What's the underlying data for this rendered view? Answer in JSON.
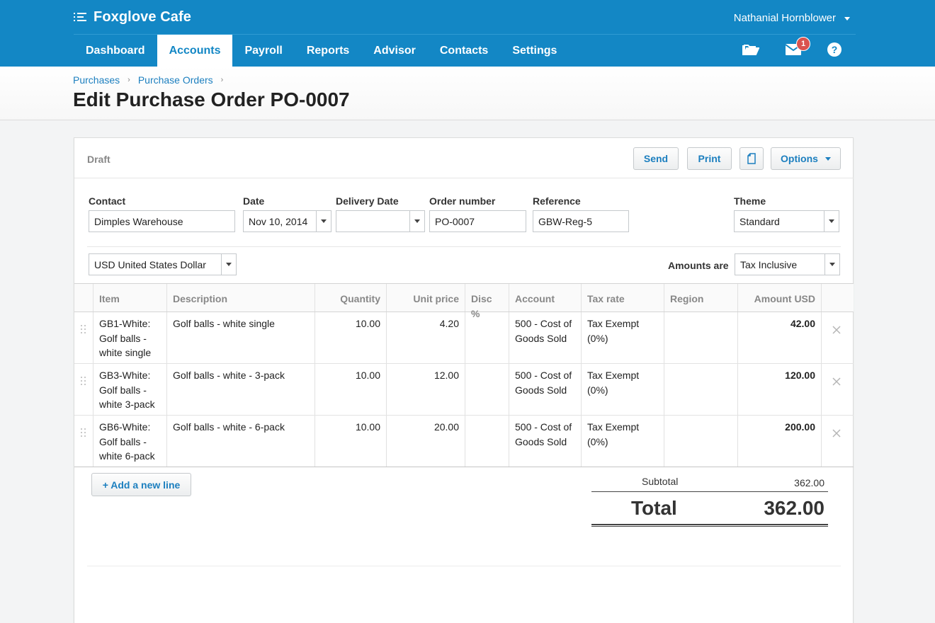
{
  "app": {
    "org_name": "Foxglove Cafe",
    "user_name": "Nathanial Hornblower",
    "notification_count": "1"
  },
  "nav": {
    "tabs": [
      {
        "label": "Dashboard",
        "active": false
      },
      {
        "label": "Accounts",
        "active": true
      },
      {
        "label": "Payroll",
        "active": false
      },
      {
        "label": "Reports",
        "active": false
      },
      {
        "label": "Advisor",
        "active": false
      },
      {
        "label": "Contacts",
        "active": false
      },
      {
        "label": "Settings",
        "active": false
      }
    ],
    "icons": [
      "folder-icon",
      "mail-icon",
      "help-icon"
    ]
  },
  "breadcrumb": [
    "Purchases",
    "Purchase Orders"
  ],
  "page_title": "Edit Purchase Order PO-0007",
  "order": {
    "status": "Draft",
    "actions": {
      "send": "Send",
      "print": "Print",
      "options": "Options"
    },
    "fields": {
      "contact": {
        "label": "Contact",
        "value": "Dimples Warehouse"
      },
      "date": {
        "label": "Date",
        "value": "Nov 10, 2014"
      },
      "delivery_date": {
        "label": "Delivery Date",
        "value": ""
      },
      "order_number": {
        "label": "Order number",
        "value": "PO-0007"
      },
      "reference": {
        "label": "Reference",
        "value": "GBW-Reg-5"
      },
      "theme": {
        "label": "Theme",
        "value": "Standard"
      }
    },
    "currency": "USD United States Dollar",
    "amounts_are": {
      "label": "Amounts are",
      "value": "Tax Inclusive"
    }
  },
  "table": {
    "headers": [
      "Item",
      "Description",
      "Quantity",
      "Unit price",
      "Disc %",
      "Account",
      "Tax rate",
      "Region",
      "Amount USD"
    ],
    "rows": [
      {
        "item": "GB1-White: Golf balls - white single",
        "description": "Golf balls - white single",
        "quantity": "10.00",
        "unit_price": "4.20",
        "disc": "",
        "account": "500 - Cost of Goods Sold",
        "tax_rate": "Tax Exempt (0%)",
        "region": "",
        "amount": "42.00"
      },
      {
        "item": "GB3-White: Golf balls - white 3-pack",
        "description": "Golf balls - white - 3-pack",
        "quantity": "10.00",
        "unit_price": "12.00",
        "disc": "",
        "account": "500 - Cost of Goods Sold",
        "tax_rate": "Tax Exempt (0%)",
        "region": "",
        "amount": "120.00"
      },
      {
        "item": "GB6-White: Golf balls - white 6-pack",
        "description": "Golf balls - white - 6-pack",
        "quantity": "10.00",
        "unit_price": "20.00",
        "disc": "",
        "account": "500 - Cost of Goods Sold",
        "tax_rate": "Tax Exempt (0%)",
        "region": "",
        "amount": "200.00"
      }
    ],
    "add_line_label": "+ Add a new line"
  },
  "totals": {
    "subtotal_label": "Subtotal",
    "subtotal_value": "362.00",
    "total_label": "Total",
    "total_value": "362.00"
  },
  "colors": {
    "brand_blue": "#1387c5",
    "link_blue": "#1c7fbf",
    "badge_red": "#d9534f"
  }
}
